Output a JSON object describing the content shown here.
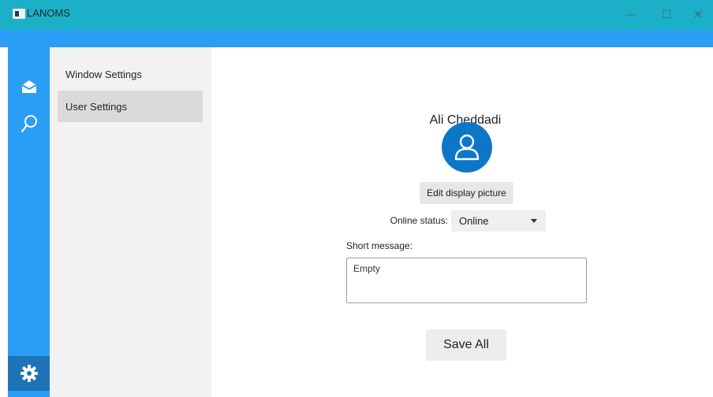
{
  "window": {
    "title": "LANOMS",
    "minimize_glyph": "—",
    "maximize_glyph": "☐",
    "close_glyph": "✕"
  },
  "nav": {
    "items": [
      {
        "icon": "envelope-open-icon"
      },
      {
        "icon": "search-icon"
      },
      {
        "icon": "gear-icon"
      }
    ]
  },
  "sidebar": {
    "items": [
      {
        "label": "Window Settings"
      },
      {
        "label": "User Settings"
      }
    ]
  },
  "profile": {
    "username": "Ali Cheddadi",
    "avatar_icon": "user-icon",
    "edit_picture_label": "Edit display picture",
    "online_status_label": "Online status:",
    "online_status_value": "Online",
    "short_message_label": "Short message:",
    "short_message_value": "Empty",
    "save_label": "Save All"
  },
  "colors": {
    "titlebar": "#1bb0c7",
    "accent_blue": "#2a9df4",
    "selected_nav": "#1d73b6",
    "avatar": "#0d77c7",
    "side_panel": "#f2f2f2",
    "selected_item": "#dadada"
  }
}
